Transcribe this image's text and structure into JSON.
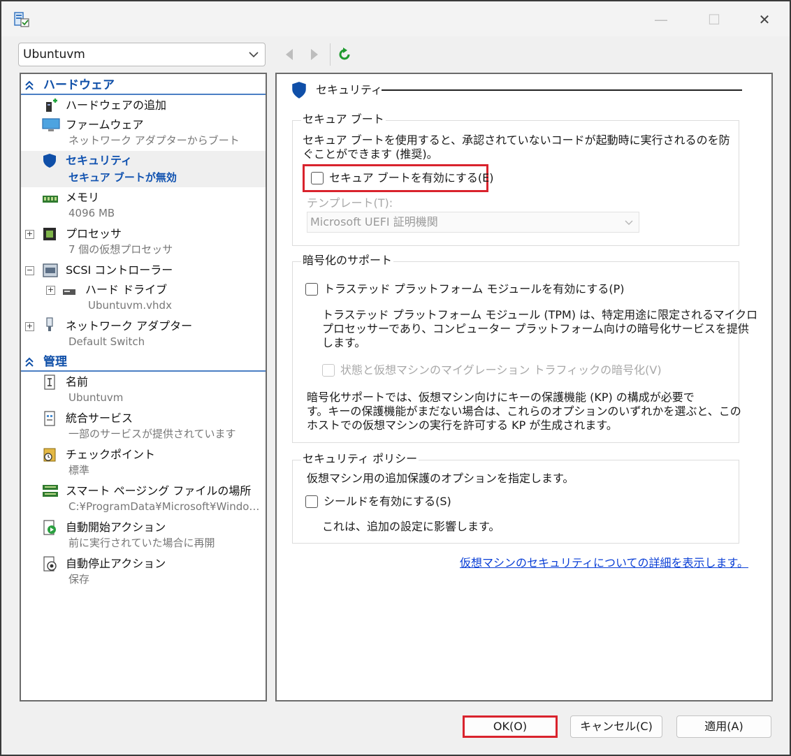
{
  "window": {
    "vm_name": "Ubuntuvm",
    "minimize_glyph": "—",
    "maximize_glyph": "☐",
    "close_glyph": "✕",
    "accent_color": "#0f4fa8",
    "highlight_color": "#d9232d"
  },
  "sidebar": {
    "hardware_label": "ハードウェア",
    "hardware_items": {
      "add_hardware": {
        "label": "ハードウェアの追加",
        "icon": "add-hardware-icon"
      },
      "firmware": {
        "label": "ファームウェア",
        "sub": "ネットワーク アダプターからブート",
        "icon": "monitor-icon"
      },
      "security": {
        "label": "セキュリティ",
        "sub": "セキュア ブートが無効",
        "icon": "shield-icon"
      },
      "memory": {
        "label": "メモリ",
        "sub": "4096 MB",
        "icon": "memory-icon"
      },
      "processor": {
        "label": "プロセッサ",
        "sub": "7 個の仮想プロセッサ",
        "icon": "cpu-icon"
      },
      "scsi": {
        "label": "SCSI コントローラー",
        "icon": "scsi-icon"
      },
      "hard_drive": {
        "label": "ハード ドライブ",
        "sub": "Ubuntuvm.vhdx",
        "icon": "drive-icon"
      },
      "network": {
        "label": "ネットワーク アダプター",
        "sub": "Default Switch",
        "icon": "network-adapter-icon"
      }
    },
    "management_label": "管理",
    "management_items": {
      "name": {
        "label": "名前",
        "sub": "Ubuntuvm",
        "icon": "name-icon"
      },
      "integration": {
        "label": "統合サービス",
        "sub": "一部のサービスが提供されています",
        "icon": "integration-icon"
      },
      "checkpoint": {
        "label": "チェックポイント",
        "sub": "標準",
        "icon": "checkpoint-icon"
      },
      "smart_paging": {
        "label": "スマート ページング ファイルの場所",
        "sub": "C:¥ProgramData¥Microsoft¥Windo…",
        "icon": "paging-icon"
      },
      "auto_start": {
        "label": "自動開始アクション",
        "sub": "前に実行されていた場合に再開",
        "icon": "auto-start-icon"
      },
      "auto_stop": {
        "label": "自動停止アクション",
        "sub": "保存",
        "icon": "auto-stop-icon"
      }
    }
  },
  "main": {
    "section_title": "セキュリティ",
    "secure_boot": {
      "group_title": "セキュア ブート",
      "description_line1": "セキュア ブートを使用すると、承認されていないコードが起動時に実行されるのを防",
      "description_line2": "ぐことができます (推奨)。",
      "enable_label": "セキュア ブートを有効にする(E)",
      "enabled": false,
      "template_label": "テンプレート(T):",
      "template_value": "Microsoft UEFI 証明機関"
    },
    "encryption": {
      "group_title": "暗号化のサポート",
      "tpm_label": "トラステッド プラットフォーム モジュールを有効にする(P)",
      "tpm_desc_line1": "トラステッド プラットフォーム モジュール (TPM) は、特定用途に限定されるマイクロ",
      "tpm_desc_line2": "プロセッサーであり、コンピューター プラットフォーム向けの暗号化サービスを提供",
      "tpm_desc_line3": "します。",
      "encrypt_traffic_label": "状態と仮想マシンのマイグレーション トラフィックの暗号化(V)",
      "kp_line1": "暗号化サポートでは、仮想マシン向けにキーの保護機能 (KP) の構成が必要で",
      "kp_line2": "す。キーの保護機能がまだない場合は、これらのオプションのいずれかを選ぶと、この",
      "kp_line3": "ホストでの仮想マシンの実行を許可する KP が生成されます。"
    },
    "policy": {
      "group_title": "セキュリティ ポリシー",
      "description": "仮想マシン用の追加保護のオプションを指定します。",
      "shield_label": "シールドを有効にする(S)",
      "note": "これは、追加の設定に影響します。"
    },
    "details_link": "仮想マシンのセキュリティについての詳細を表示します。"
  },
  "buttons": {
    "ok": "OK(O)",
    "cancel": "キャンセル(C)",
    "apply": "適用(A)"
  }
}
